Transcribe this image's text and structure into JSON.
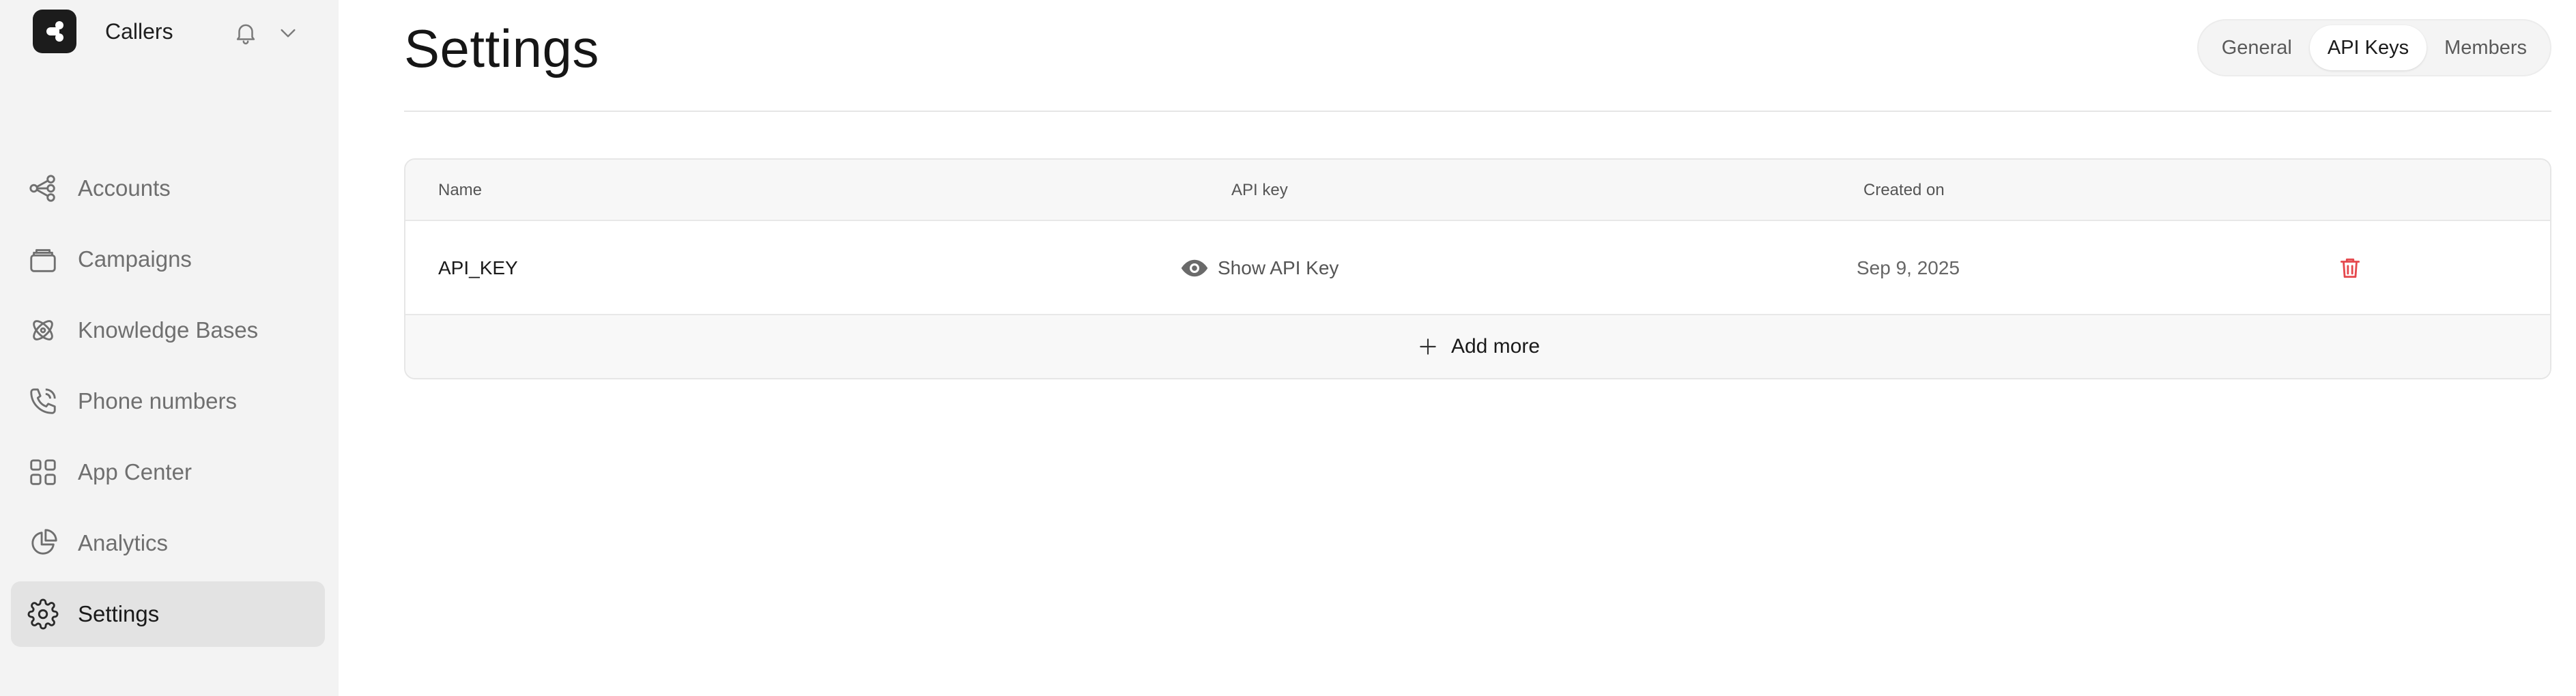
{
  "app": {
    "name": "Callers"
  },
  "sidebar": {
    "items": [
      {
        "label": "Accounts",
        "icon": "accounts-icon"
      },
      {
        "label": "Campaigns",
        "icon": "campaigns-icon"
      },
      {
        "label": "Knowledge Bases",
        "icon": "knowledge-icon"
      },
      {
        "label": "Phone numbers",
        "icon": "phone-icon"
      },
      {
        "label": "App Center",
        "icon": "grid-icon"
      },
      {
        "label": "Analytics",
        "icon": "pie-chart-icon"
      },
      {
        "label": "Settings",
        "icon": "gear-icon",
        "active": true
      }
    ]
  },
  "page": {
    "title": "Settings",
    "tabs": [
      {
        "label": "General"
      },
      {
        "label": "API Keys",
        "active": true
      },
      {
        "label": "Members"
      }
    ]
  },
  "table": {
    "headers": {
      "name": "Name",
      "api_key": "API key",
      "created_on": "Created on"
    },
    "rows": [
      {
        "name": "API_KEY",
        "action": "Show API Key",
        "created_on": "Sep 9, 2025"
      }
    ],
    "add_more": "Add more"
  },
  "colors": {
    "sidebar_bg": "#f3f3f3",
    "active_nav_bg": "#e3e3e3",
    "delete_red": "#e5484d"
  }
}
